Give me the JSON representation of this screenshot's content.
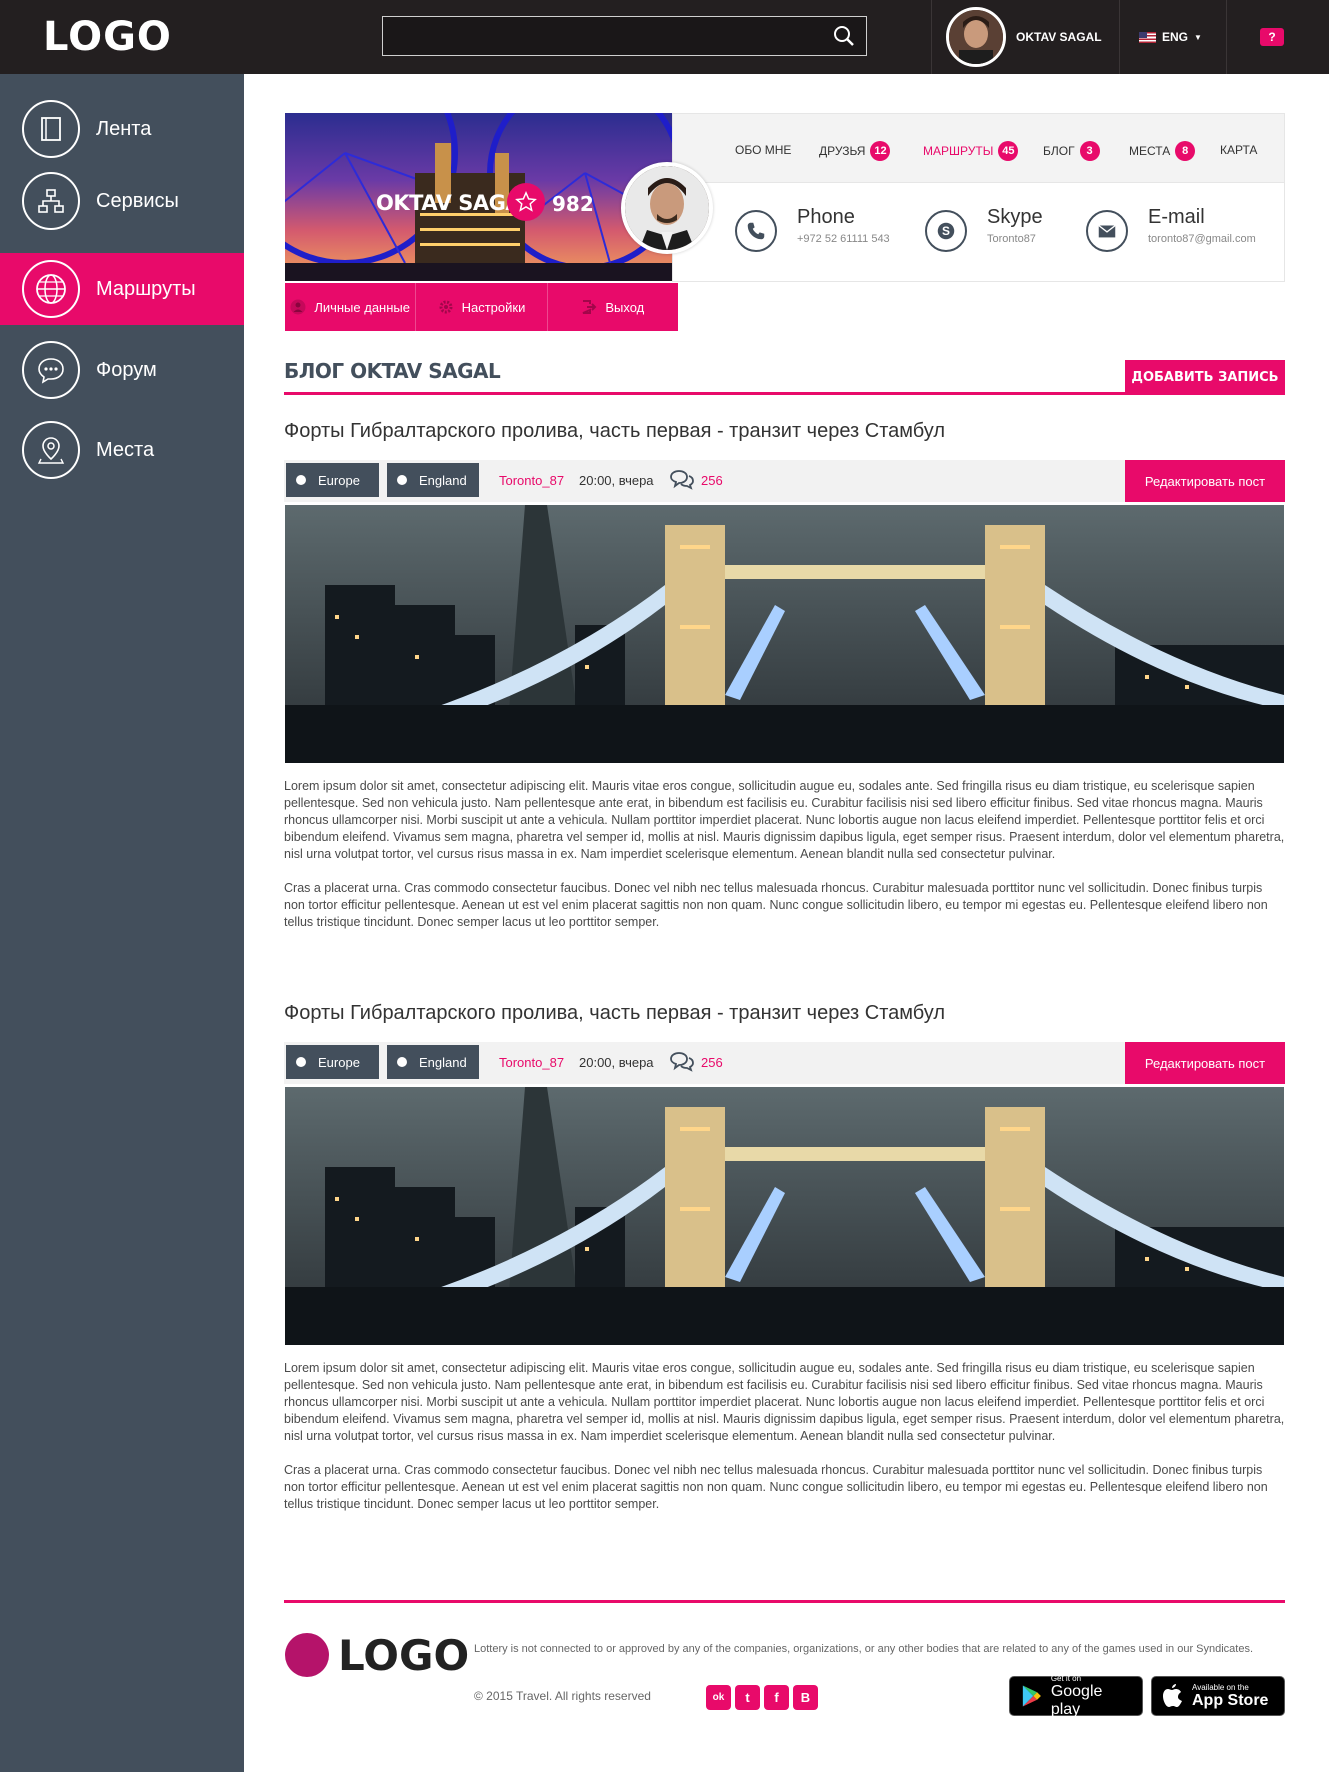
{
  "header": {
    "logo": "LOGO",
    "search_placeholder": "",
    "user_name": "OKTAV SAGAL",
    "language": "ENG",
    "help": "?"
  },
  "sidebar": {
    "items": [
      {
        "label": "Лента",
        "icon": "book-icon",
        "active": false
      },
      {
        "label": "Сервисы",
        "icon": "sitemap-icon",
        "active": false
      },
      {
        "label": "Маршруты",
        "icon": "globe-icon",
        "active": true
      },
      {
        "label": "Форум",
        "icon": "chat-bubble-icon",
        "active": false
      },
      {
        "label": "Места",
        "icon": "map-pin-icon",
        "active": false
      }
    ]
  },
  "profile": {
    "name": "OKTAV SAGAL",
    "score": "982",
    "nav": [
      {
        "label": "ОБО МНЕ",
        "badge": null,
        "active": false
      },
      {
        "label": "ДРУЗЬЯ",
        "badge": "12",
        "active": false
      },
      {
        "label": "МАРШРУТЫ",
        "badge": "45",
        "active": true
      },
      {
        "label": "БЛОГ",
        "badge": "3",
        "active": false
      },
      {
        "label": "МЕСТА",
        "badge": "8",
        "active": false
      },
      {
        "label": "КАРТА",
        "badge": null,
        "active": false
      }
    ],
    "contacts": [
      {
        "title": "Phone",
        "value": "+972 52 61111 543",
        "icon": "phone-icon"
      },
      {
        "title": "Skype",
        "value": "Toronto87",
        "icon": "skype-icon"
      },
      {
        "title": "E-mail",
        "value": "toronto87@gmail.com",
        "icon": "envelope-icon"
      }
    ],
    "actions": [
      {
        "label": "Личные данные",
        "icon": "user-icon"
      },
      {
        "label": "Настройки",
        "icon": "gear-icon"
      },
      {
        "label": "Выход",
        "icon": "logout-icon"
      }
    ]
  },
  "blog": {
    "title": "БЛОГ OKTAV SAGAL",
    "add_button": "ДОБАВИТЬ ЗАПИСЬ",
    "posts": [
      {
        "title": "Форты Гибралтарского пролива, часть первая - транзит через Стамбул",
        "tags": [
          "Europe",
          "England"
        ],
        "author": "Toronto_87",
        "time": "20:00, вчера",
        "comments": "256",
        "edit_button": "Редактировать пост",
        "paragraphs": [
          "Lorem ipsum dolor sit amet, consectetur adipiscing elit. Mauris vitae eros congue, sollicitudin augue eu, sodales ante. Sed fringilla risus eu diam tristique, eu scelerisque sapien pellentesque. Sed non vehicula justo. Nam pellentesque ante erat, in bibendum est facilisis eu. Curabitur facilisis nisi sed libero efficitur finibus. Sed vitae rhoncus magna. Mauris rhoncus ullamcorper nisi. Morbi suscipit ut ante a vehicula. Nullam porttitor imperdiet placerat. Nunc lobortis augue non lacus eleifend imperdiet. Pellentesque porttitor felis et orci bibendum eleifend. Vivamus sem magna, pharetra vel semper id, mollis at nisl. Mauris dignissim dapibus ligula, eget semper risus. Praesent interdum, dolor vel elementum pharetra, nisl urna volutpat tortor, vel cursus risus massa in ex. Nam imperdiet scelerisque elementum. Aenean blandit nulla sed consectetur pulvinar.",
          "Cras a placerat urna. Cras commodo consectetur faucibus. Donec vel nibh nec tellus malesuada rhoncus. Curabitur malesuada porttitor nunc vel sollicitudin. Donec finibus turpis non tortor efficitur pellentesque. Aenean ut est vel enim placerat sagittis non non quam. Nunc congue sollicitudin libero, eu tempor mi egestas eu. Pellentesque eleifend libero non tellus tristique tincidunt. Donec semper lacus ut leo porttitor semper."
        ]
      },
      {
        "title": "Форты Гибралтарского пролива, часть первая - транзит через Стамбул",
        "tags": [
          "Europe",
          "England"
        ],
        "author": "Toronto_87",
        "time": "20:00, вчера",
        "comments": "256",
        "edit_button": "Редактировать пост",
        "paragraphs": [
          "Lorem ipsum dolor sit amet, consectetur adipiscing elit. Mauris vitae eros congue, sollicitudin augue eu, sodales ante. Sed fringilla risus eu diam tristique, eu scelerisque sapien pellentesque. Sed non vehicula justo. Nam pellentesque ante erat, in bibendum est facilisis eu. Curabitur facilisis nisi sed libero efficitur finibus. Sed vitae rhoncus magna. Mauris rhoncus ullamcorper nisi. Morbi suscipit ut ante a vehicula. Nullam porttitor imperdiet placerat. Nunc lobortis augue non lacus eleifend imperdiet. Pellentesque porttitor felis et orci bibendum eleifend. Vivamus sem magna, pharetra vel semper id, mollis at nisl. Mauris dignissim dapibus ligula, eget semper risus. Praesent interdum, dolor vel elementum pharetra, nisl urna volutpat tortor, vel cursus risus massa in ex. Nam imperdiet scelerisque elementum. Aenean blandit nulla sed consectetur pulvinar.",
          "Cras a placerat urna. Cras commodo consectetur faucibus. Donec vel nibh nec tellus malesuada rhoncus. Curabitur malesuada porttitor nunc vel sollicitudin. Donec finibus turpis non tortor efficitur pellentesque. Aenean ut est vel enim placerat sagittis non non quam. Nunc congue sollicitudin libero, eu tempor mi egestas eu. Pellentesque eleifend libero non tellus tristique tincidunt. Donec semper lacus ut leo porttitor semper."
        ]
      }
    ]
  },
  "footer": {
    "logo": "LOGO",
    "disclaimer": "Lottery is not connected to or approved by any of the companies, organizations, or any other bodies that are related to any of the games used in our Syndicates.",
    "copyright": "© 2015 Travel. All rights reserved",
    "socials": [
      {
        "icon": "odnoklassniki-icon",
        "glyph": "ok"
      },
      {
        "icon": "twitter-icon",
        "glyph": "t"
      },
      {
        "icon": "facebook-icon",
        "glyph": "f"
      },
      {
        "icon": "vk-icon",
        "glyph": "B"
      }
    ],
    "stores": [
      {
        "small": "Get it on",
        "big": "Google play",
        "icon": "google-play-icon"
      },
      {
        "small": "Available on the",
        "big": "App Store",
        "icon": "apple-icon"
      }
    ]
  },
  "colors": {
    "accent": "#e80a6a",
    "sidebar": "#434f5c",
    "topbar": "#231f20"
  }
}
